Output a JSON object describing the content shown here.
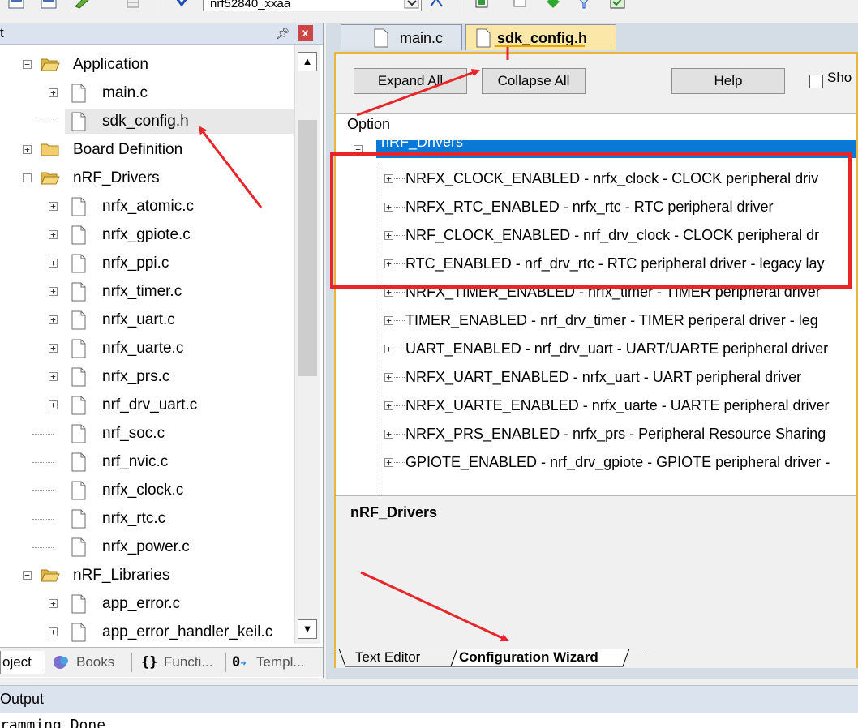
{
  "toolbar": {
    "target_name": "nrf52840_xxaa",
    "icons": [
      "load-icon",
      "save-icon",
      "pencil-icon",
      "grid-icon",
      "download-icon",
      "settings-icon",
      "open-icon",
      "flash-icon",
      "diamond-icon",
      "filter-icon",
      "check-icon"
    ]
  },
  "project_panel": {
    "title": "t",
    "pin": "ᵖ",
    "close": "x",
    "tree": [
      {
        "label": "Application",
        "type": "folder",
        "expanded": true,
        "depth": 0
      },
      {
        "label": "main.c",
        "type": "file",
        "expander": true,
        "depth": 1
      },
      {
        "label": "sdk_config.h",
        "type": "file",
        "expander": false,
        "depth": 1,
        "selected": true
      },
      {
        "label": "Board Definition",
        "type": "folder",
        "expanded": false,
        "depth": 0
      },
      {
        "label": "nRF_Drivers",
        "type": "folder",
        "expanded": true,
        "depth": 0
      },
      {
        "label": "nrfx_atomic.c",
        "type": "file",
        "expander": true,
        "depth": 1
      },
      {
        "label": "nrfx_gpiote.c",
        "type": "file",
        "expander": true,
        "depth": 1
      },
      {
        "label": "nrfx_ppi.c",
        "type": "file",
        "expander": true,
        "depth": 1
      },
      {
        "label": "nrfx_timer.c",
        "type": "file",
        "expander": true,
        "depth": 1
      },
      {
        "label": "nrfx_uart.c",
        "type": "file",
        "expander": true,
        "depth": 1
      },
      {
        "label": "nrfx_uarte.c",
        "type": "file",
        "expander": true,
        "depth": 1
      },
      {
        "label": "nrfx_prs.c",
        "type": "file",
        "expander": true,
        "depth": 1
      },
      {
        "label": "nrf_drv_uart.c",
        "type": "file",
        "expander": true,
        "depth": 1
      },
      {
        "label": "nrf_soc.c",
        "type": "file",
        "expander": false,
        "depth": 1
      },
      {
        "label": "nrf_nvic.c",
        "type": "file",
        "expander": false,
        "depth": 1
      },
      {
        "label": "nrfx_clock.c",
        "type": "file",
        "expander": false,
        "depth": 1
      },
      {
        "label": "nrfx_rtc.c",
        "type": "file",
        "expander": false,
        "depth": 1
      },
      {
        "label": "nrfx_power.c",
        "type": "file",
        "expander": false,
        "depth": 1
      },
      {
        "label": "nRF_Libraries",
        "type": "folder",
        "expanded": true,
        "depth": 0
      },
      {
        "label": "app_error.c",
        "type": "file",
        "expander": true,
        "depth": 1
      },
      {
        "label": "app_error_handler_keil.c",
        "type": "file",
        "expander": true,
        "depth": 1
      }
    ],
    "tabs": {
      "project": "oject",
      "books": "Books",
      "functions": "Functi...",
      "templates": "Templ..."
    }
  },
  "editor": {
    "tabs": {
      "main": "main.c",
      "sdk": "sdk_config.h"
    },
    "wizard": {
      "expand_all": "Expand All",
      "collapse_all": "Collapse All",
      "help": "Help",
      "show_label": "Sho",
      "option_header": "Option",
      "root": "nRF_Drivers",
      "options": [
        "NRFX_CLOCK_ENABLED - nrfx_clock - CLOCK peripheral driv",
        "NRFX_RTC_ENABLED - nrfx_rtc - RTC peripheral driver",
        "NRF_CLOCK_ENABLED - nrf_drv_clock - CLOCK peripheral dr",
        "RTC_ENABLED - nrf_drv_rtc - RTC peripheral driver - legacy lay",
        "NRFX_TIMER_ENABLED - nrfx_timer - TIMER peripheral driver",
        "TIMER_ENABLED - nrf_drv_timer - TIMER periperal driver - leg",
        "UART_ENABLED - nrf_drv_uart - UART/UARTE peripheral driver",
        "NRFX_UART_ENABLED - nrfx_uart - UART peripheral driver",
        "NRFX_UARTE_ENABLED - nrfx_uarte - UARTE peripheral driver",
        "NRFX_PRS_ENABLED - nrfx_prs - Peripheral Resource Sharing",
        "GPIOTE_ENABLED - nrf_drv_gpiote - GPIOTE peripheral driver -"
      ],
      "description_title": "nRF_Drivers",
      "bottom_tabs": {
        "text_editor": "Text Editor",
        "config_wizard": "Configuration Wizard"
      }
    }
  },
  "output": {
    "title": "Output",
    "text": "ramming Done"
  },
  "colors": {
    "annotation": "#e8262a",
    "selection": "#0a78d7",
    "active_tab": "#fbe7a8"
  }
}
